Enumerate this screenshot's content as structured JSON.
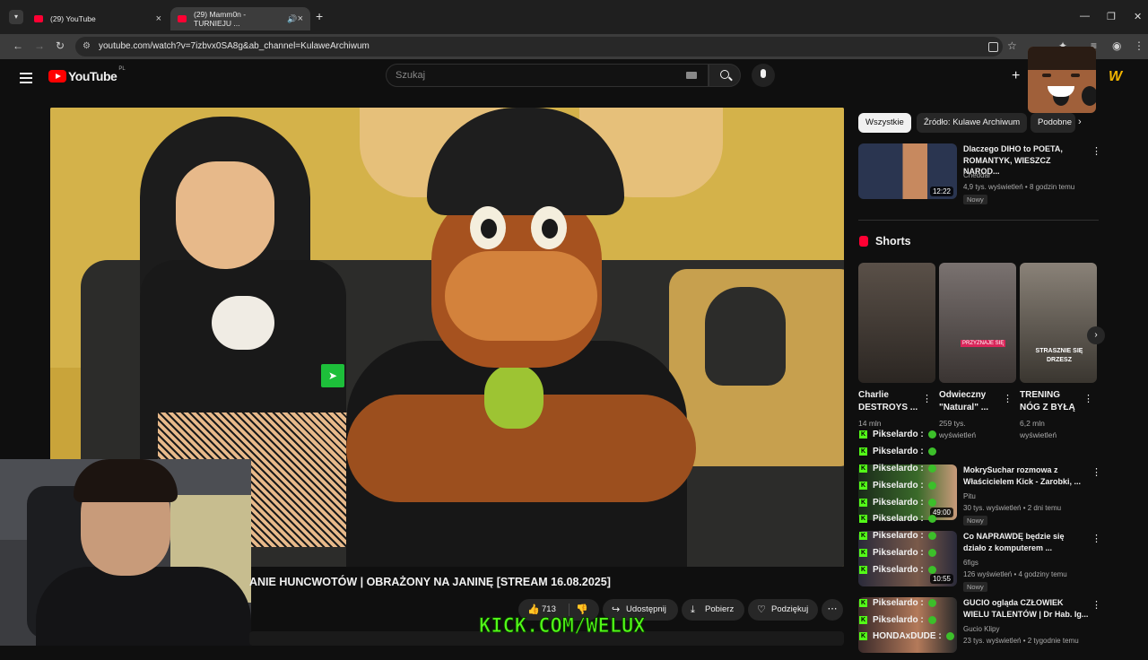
{
  "browser": {
    "tabs": [
      {
        "title": "(29) YouTube",
        "active": false
      },
      {
        "title": "(29) Mamm0n - TURNIEJU ...",
        "active": true
      }
    ],
    "url": "youtube.com/watch?v=7izbvx0SA8g&ab_channel=KulaweArchiwum"
  },
  "header": {
    "logo_text": "YouTube",
    "region": "PL",
    "search_placeholder": "Szukaj"
  },
  "video": {
    "title": "ANIE HUNCWOTÓW | OBRAŻONY NA JANINĘ [STREAM 16.08.2025]",
    "likes": "713",
    "share_label": "Udostępnij",
    "download_label": "Pobierz",
    "thanks_label": "Podziękuj",
    "overlay_text": "KICK.COM/WELUX"
  },
  "sidebar": {
    "chips": [
      "Wszystkie",
      "Źródło: Kulawe Archiwum",
      "Podobne"
    ],
    "recs": [
      {
        "title": "Dlaczego DIHO to POETA, ROMANTYK, WIESZCZ NAROD...",
        "channel": "Cheddar",
        "meta": "4,9 tys. wyświetleń • 8 godzin temu",
        "badge": "Nowy",
        "duration": "12:22"
      },
      {
        "title": "MokrySuchar rozmowa z Właścicielem Kick - Zarobki, ...",
        "channel": "Pitu",
        "meta": "30 tys. wyświetleń • 2 dni temu",
        "badge": "Nowy",
        "duration": "49:00"
      },
      {
        "title": "Co NAPRAWDĘ będzie się działo z komputerem ...",
        "channel": "6figs",
        "meta": "126 wyświetleń • 4 godziny temu",
        "badge": "Nowy",
        "duration": "10:55"
      },
      {
        "title": "GUCIO ogląda CZŁOWIEK WIELU TALENTÓW | Dr Hab. Ig...",
        "channel": "Gucio Klipy",
        "meta": "23 tys. wyświetleń • 2 tygodnie temu",
        "badge": "",
        "duration": ""
      }
    ],
    "shorts_heading": "Shorts",
    "shorts": [
      {
        "title": "Charlie DESTROYS ...",
        "views": "14 mln",
        "views2": ""
      },
      {
        "title": "Odwieczny \"Natural\" ...",
        "views": "259 tys.",
        "views2": "wyświetleń"
      },
      {
        "title": "TRENING NÓG Z BYŁĄ",
        "views": "6,2 mln",
        "views2": "wyświetleń"
      }
    ],
    "short_overlays": [
      "PRZYZNAJE SIĘ",
      "STRASZNIE SIĘ DRZESZ"
    ],
    "chat": [
      {
        "user": "Pikselardo :"
      },
      {
        "user": "Pikselardo :"
      },
      {
        "user": "Pikselardo :"
      },
      {
        "user": "Pikselardo :"
      },
      {
        "user": "Pikselardo :"
      },
      {
        "user": "Pikselardo :"
      },
      {
        "user": "Pikselardo :"
      },
      {
        "user": "Pikselardo :"
      },
      {
        "user": "Pikselardo :"
      },
      {
        "user": "HONDAxDUDE :"
      }
    ]
  }
}
